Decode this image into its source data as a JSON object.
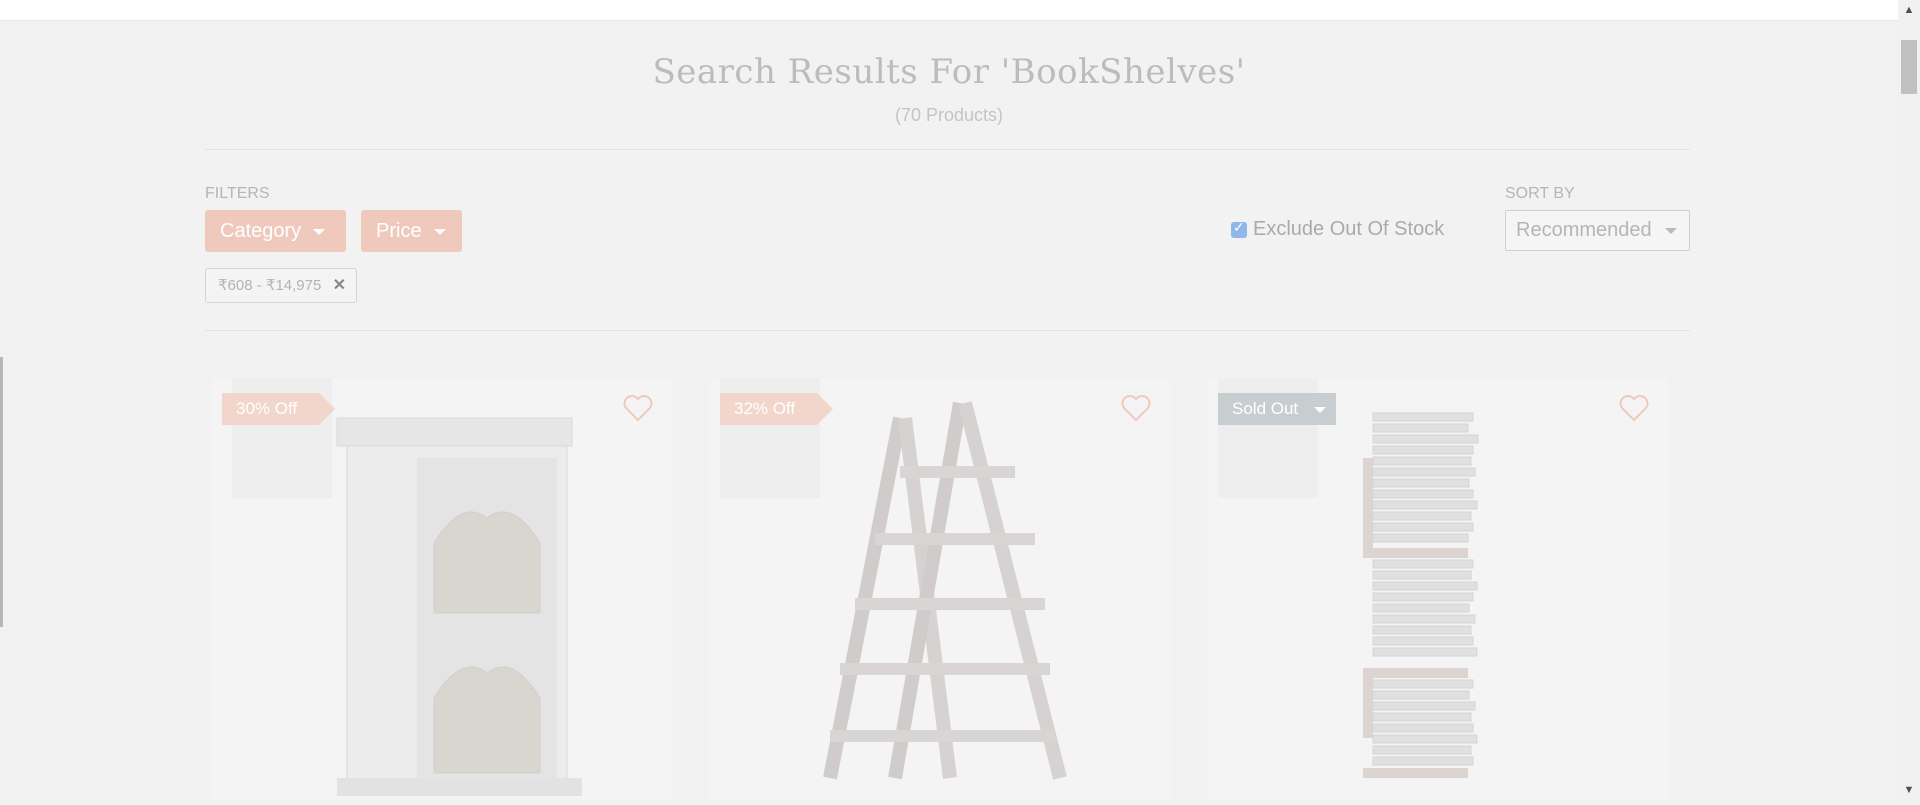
{
  "search": {
    "title": "Search Results For 'BookShelves'",
    "count": "(70 Products)"
  },
  "filters": {
    "label": "FILTERS",
    "category_label": "Category",
    "price_label": "Price",
    "active_chip": "₹608 - ₹14,975",
    "exclude_out_of_stock_label": "Exclude Out Of Stock",
    "exclude_out_of_stock_checked": true
  },
  "sort": {
    "label": "SORT BY",
    "selected": "Recommended"
  },
  "products": [
    {
      "badge": "30% Off",
      "badge_type": "offer",
      "image": "white-arched-cabinet"
    },
    {
      "badge": "32% Off",
      "badge_type": "offer",
      "image": "a-frame-ladder-shelf"
    },
    {
      "badge": "Sold Out",
      "badge_type": "soldout",
      "image": "floating-book-tower"
    }
  ],
  "colors": {
    "accent": "#f0c9bd",
    "soldout": "#c8cdd0",
    "background": "#f2f2f2",
    "heart": "#f0c9bd"
  },
  "icons": {
    "wishlist": "heart-icon",
    "remove": "close-icon",
    "dropdown": "caret-down-icon"
  }
}
